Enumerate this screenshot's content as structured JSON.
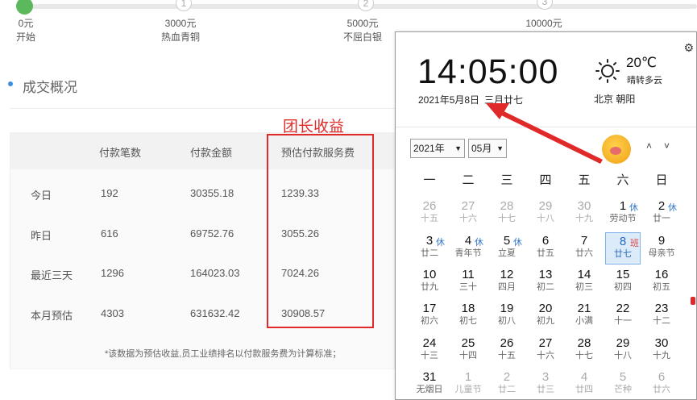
{
  "progress": {
    "steps": [
      {
        "num": "",
        "amount": "0元",
        "level": "开始"
      },
      {
        "num": "1",
        "amount": "3000元",
        "level": "热血青铜"
      },
      {
        "num": "2",
        "amount": "5000元",
        "level": "不屈白银"
      },
      {
        "num": "3",
        "amount": "10000元",
        "level": ""
      }
    ]
  },
  "section_title": "成交概况",
  "annotation": "团长收益",
  "table": {
    "headers": [
      "",
      "付款笔数",
      "付款金额",
      "预估付款服务费"
    ],
    "rows": [
      [
        "今日",
        "192",
        "30355.18",
        "1239.33"
      ],
      [
        "昨日",
        "616",
        "69752.76",
        "3055.26"
      ],
      [
        "最近三天",
        "1296",
        "164023.03",
        "7024.26"
      ],
      [
        "本月预估",
        "4303",
        "631632.42",
        "30908.57"
      ]
    ],
    "note": "*该数据为预估收益,员工业绩排名以付款服务费为计算标准；"
  },
  "calendar": {
    "time": "14:05:00",
    "date": "2021年5月8日",
    "lunar": "三月廿七",
    "temp": "20℃",
    "weather": "晴转多云",
    "city": "北京 朝阳",
    "weather_icon": "sun-icon",
    "settings_icon": "gear-icon",
    "year_select": "2021年",
    "month_select": "05月",
    "nav_up": "˄",
    "nav_down": "˅",
    "weekdays": [
      "一",
      "二",
      "三",
      "四",
      "五",
      "六",
      "日"
    ],
    "weeks": [
      [
        [
          "26",
          "十五",
          1,
          ""
        ],
        [
          "27",
          "十六",
          1,
          ""
        ],
        [
          "28",
          "十七",
          1,
          ""
        ],
        [
          "29",
          "十八",
          1,
          ""
        ],
        [
          "30",
          "十九",
          1,
          ""
        ],
        [
          "1",
          "劳动节",
          0,
          "休"
        ],
        [
          "2",
          "廿一",
          0,
          "休"
        ]
      ],
      [
        [
          "3",
          "廿二",
          0,
          "休"
        ],
        [
          "4",
          "青年节",
          0,
          "休"
        ],
        [
          "5",
          "立夏",
          0,
          "休"
        ],
        [
          "6",
          "廿五",
          0,
          ""
        ],
        [
          "7",
          "廿六",
          0,
          ""
        ],
        [
          "8",
          "廿七",
          0,
          "班"
        ],
        [
          "9",
          "母亲节",
          0,
          ""
        ]
      ],
      [
        [
          "10",
          "廿九",
          0,
          ""
        ],
        [
          "11",
          "三十",
          0,
          ""
        ],
        [
          "12",
          "四月",
          0,
          ""
        ],
        [
          "13",
          "初二",
          0,
          ""
        ],
        [
          "14",
          "初三",
          0,
          ""
        ],
        [
          "15",
          "初四",
          0,
          ""
        ],
        [
          "16",
          "初五",
          0,
          ""
        ]
      ],
      [
        [
          "17",
          "初六",
          0,
          ""
        ],
        [
          "18",
          "初七",
          0,
          ""
        ],
        [
          "19",
          "初八",
          0,
          ""
        ],
        [
          "20",
          "初九",
          0,
          ""
        ],
        [
          "21",
          "小满",
          0,
          ""
        ],
        [
          "22",
          "十一",
          0,
          ""
        ],
        [
          "23",
          "十二",
          0,
          ""
        ]
      ],
      [
        [
          "24",
          "十三",
          0,
          ""
        ],
        [
          "25",
          "十四",
          0,
          ""
        ],
        [
          "26",
          "十五",
          0,
          ""
        ],
        [
          "27",
          "十六",
          0,
          ""
        ],
        [
          "28",
          "十七",
          0,
          ""
        ],
        [
          "29",
          "十八",
          0,
          ""
        ],
        [
          "30",
          "十九",
          0,
          ""
        ]
      ],
      [
        [
          "31",
          "无烟日",
          0,
          ""
        ],
        [
          "1",
          "儿童节",
          1,
          ""
        ],
        [
          "2",
          "廿二",
          1,
          ""
        ],
        [
          "3",
          "廿三",
          1,
          ""
        ],
        [
          "4",
          "廿四",
          1,
          ""
        ],
        [
          "5",
          "芒种",
          1,
          ""
        ],
        [
          "6",
          "廿六",
          1,
          ""
        ]
      ]
    ],
    "today": "8",
    "colors": {
      "rest": "#3278c8",
      "work": "#e04040",
      "today_bg": "#dcebfa",
      "annotation": "#e02a2a"
    }
  }
}
